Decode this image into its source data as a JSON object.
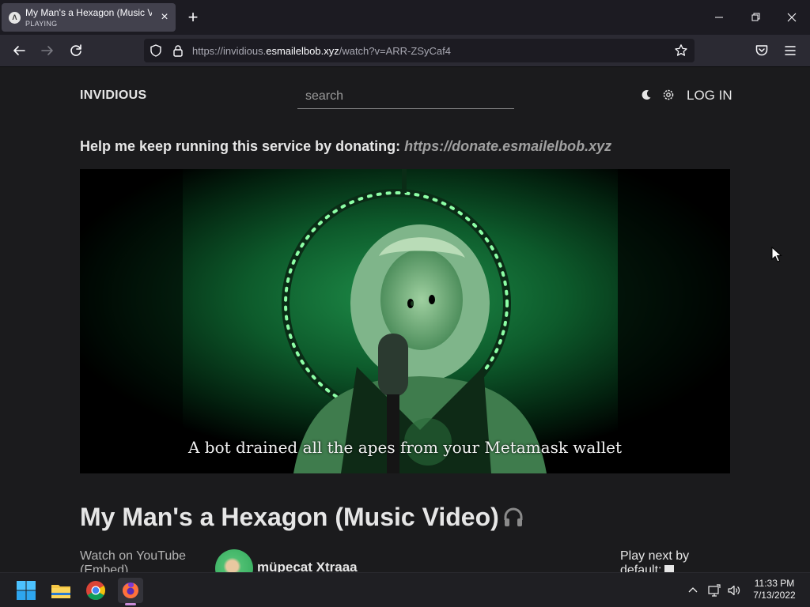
{
  "browser": {
    "tab": {
      "title": "My Man's a Hexagon (Music Vi",
      "status": "PLAYING",
      "close_label": "×"
    },
    "new_tab_label": "+",
    "url": {
      "prefix": "https://invidious.",
      "host": "esmailelbob.xyz",
      "path": "/watch?v=ARR-ZSyCaf4"
    }
  },
  "header": {
    "brand": "INVIDIOUS",
    "search_placeholder": "search",
    "login_label": "LOG IN"
  },
  "donate": {
    "text": "Help me keep running this service by donating: ",
    "link": "https://donate.esmailelbob.xyz"
  },
  "video": {
    "caption": "A bot drained all the apes from your Metamask wallet"
  },
  "watch": {
    "title": "My Man's a Hexagon (Music Video)",
    "title_icon": "headphones-icon",
    "watch_on_youtube": "Watch on YouTube",
    "embed": "(Embed)",
    "channel_name": "müpecat Xtraaa",
    "play_next": "Play next by",
    "play_next_default": "default:"
  },
  "taskbar": {
    "time": "11:33 PM",
    "date": "7/13/2022",
    "active_accent": "#c98cd8"
  }
}
